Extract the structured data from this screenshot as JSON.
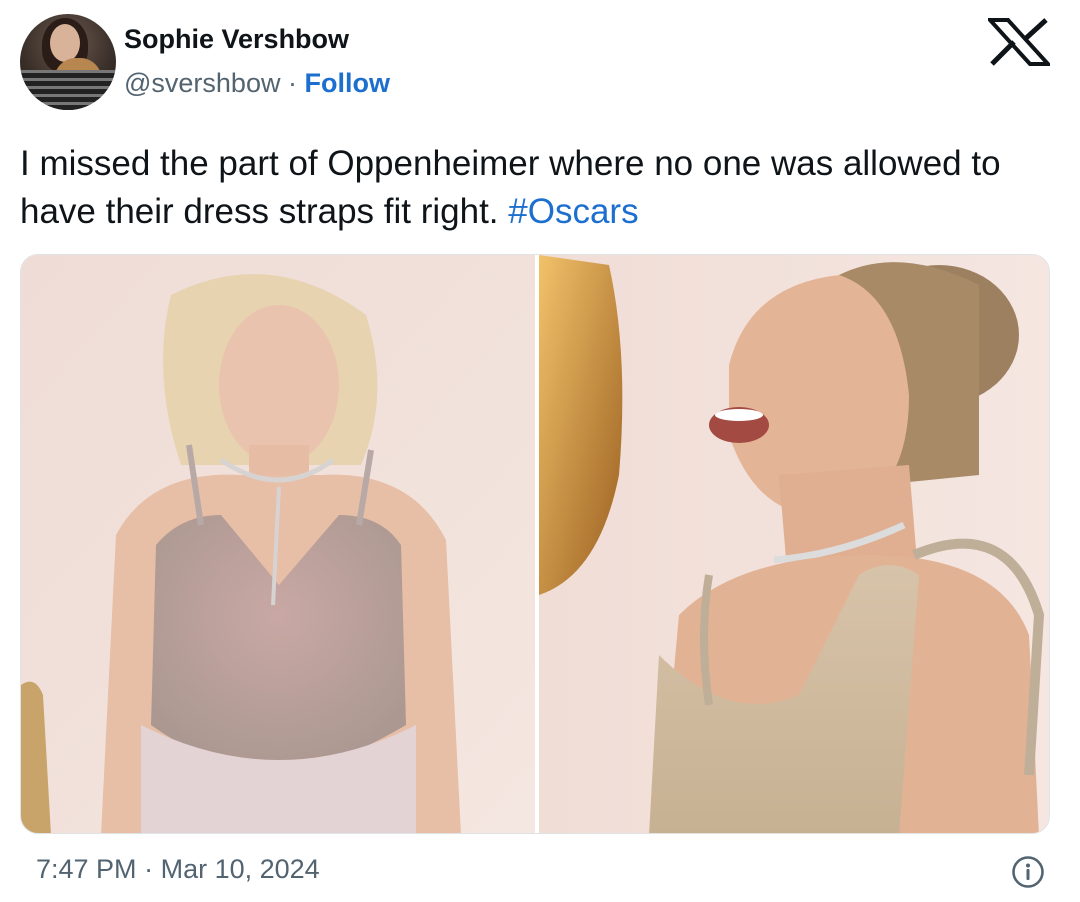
{
  "author": {
    "name": "Sophie Vershbow",
    "handle": "@svershbow",
    "separator": "·",
    "follow_label": "Follow"
  },
  "tweet": {
    "text": "I missed the part of Oppenheimer where no one was allowed to have their dress straps fit right. ",
    "hashtag": "#Oscars"
  },
  "media": {
    "images": [
      {
        "name": "photo-left",
        "description": "blonde woman in silver beaded gown with loose straps"
      },
      {
        "name": "photo-right",
        "description": "woman with updo laughing in beaded dress with loose straps"
      }
    ]
  },
  "meta": {
    "time": "7:47 PM",
    "separator": "·",
    "date": "Mar 10, 2024"
  },
  "icons": {
    "logo": "x-logo-icon",
    "info": "info-icon"
  },
  "colors": {
    "link": "#1d6fcf",
    "secondary_text": "#536471",
    "primary_text": "#0f1419"
  }
}
